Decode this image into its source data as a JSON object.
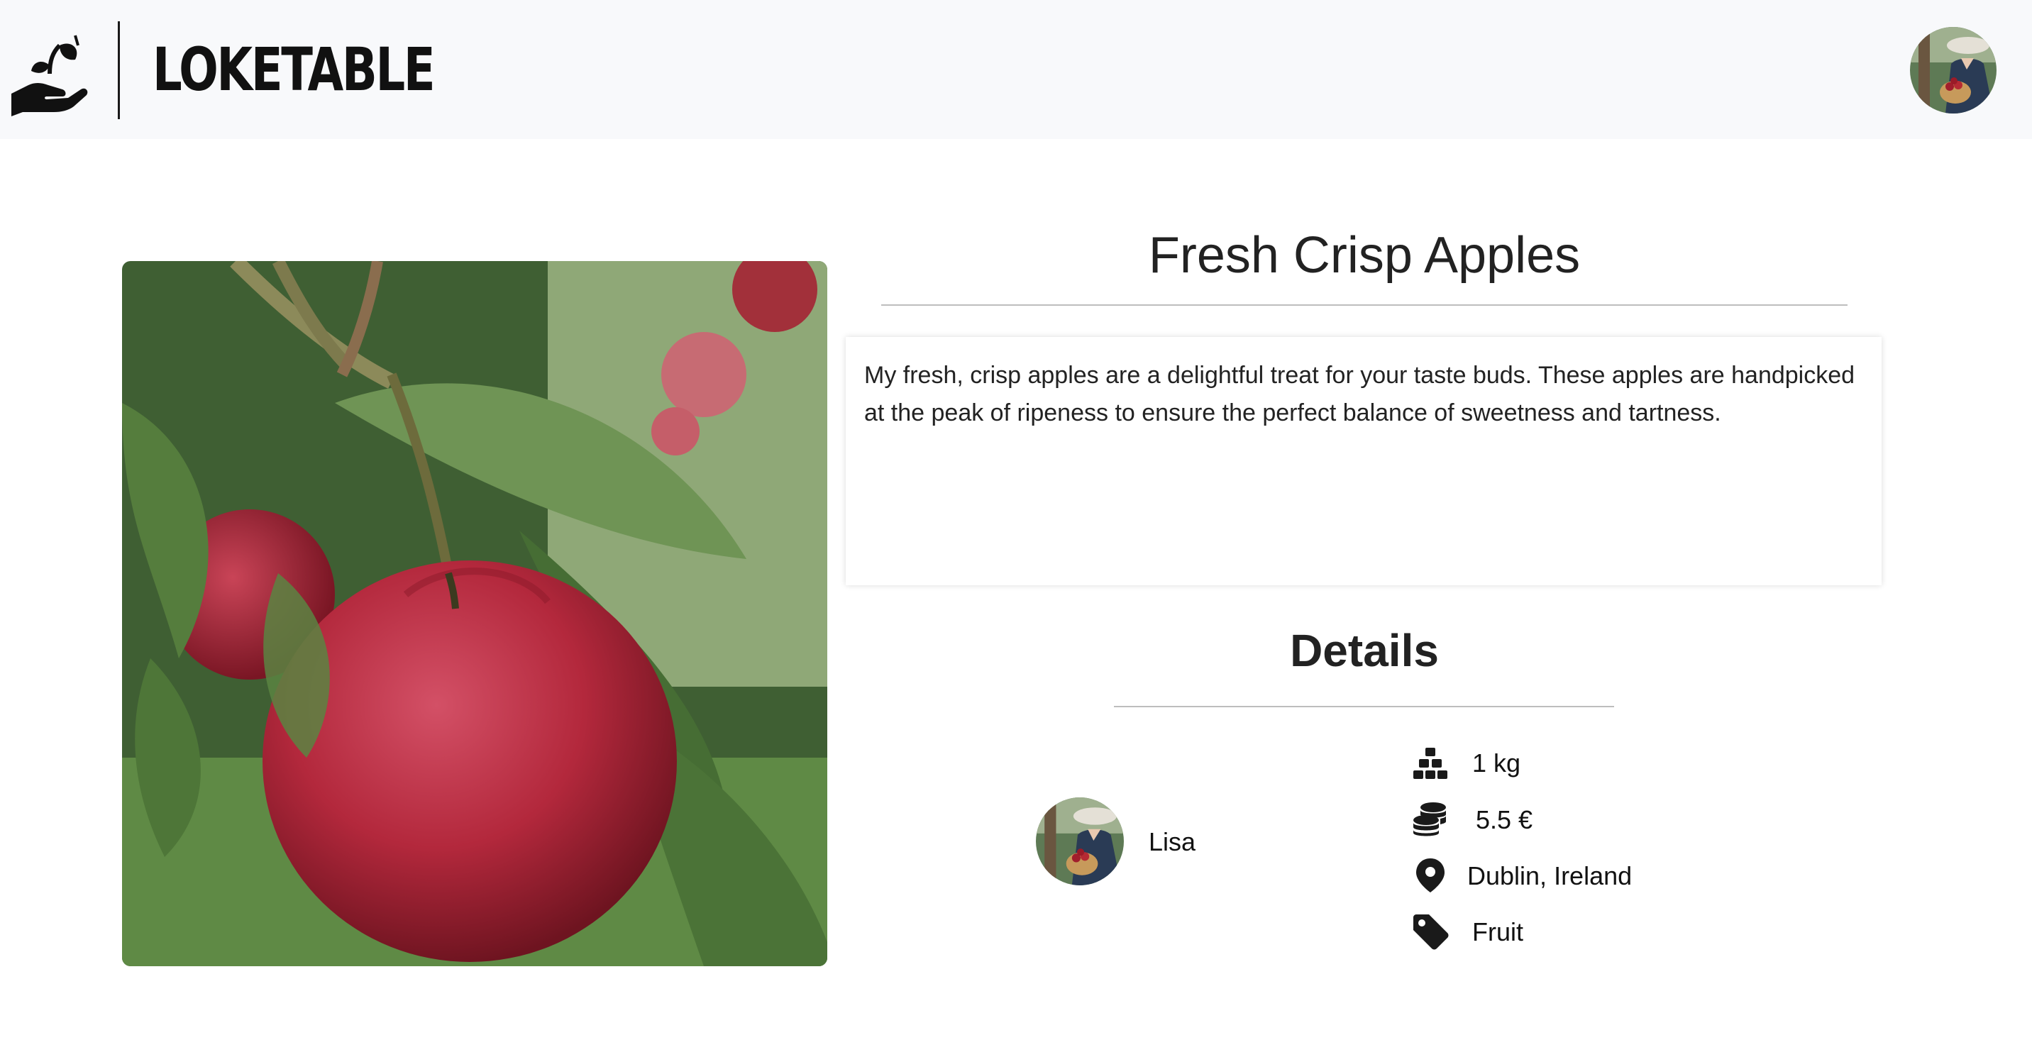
{
  "header": {
    "brand": "LOKETABLE",
    "logo_icon": "hand-with-sprout-icon",
    "user_avatar": "user-avatar"
  },
  "product": {
    "title": "Fresh Crisp Apples",
    "description": "My fresh, crisp apples are a delightful treat for your taste buds. These apples are handpicked at the peak of ripeness to ensure the perfect balance of sweetness and tartness.",
    "image": "red-apple-on-branch"
  },
  "details": {
    "heading": "Details",
    "seller": {
      "name": "Lisa"
    },
    "quantity": {
      "icon": "stacked-boxes-icon",
      "value": "1 kg"
    },
    "price": {
      "icon": "coins-icon",
      "value": "5.5 €"
    },
    "location": {
      "icon": "map-pin-icon",
      "value": "Dublin, Ireland"
    },
    "category": {
      "icon": "tag-icon",
      "value": "Fruit"
    }
  },
  "colors": {
    "header_bg": "#f8f9fb",
    "text": "#222222",
    "rule": "#bdbdbd",
    "apple_red": "#b3283c",
    "leaf_green": "#4f7a3a"
  }
}
